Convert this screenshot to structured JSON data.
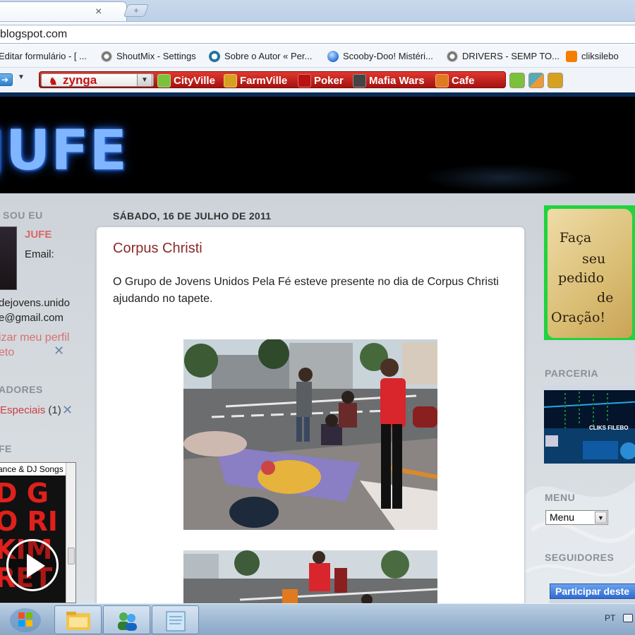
{
  "browser": {
    "tab_close": "×",
    "new_tab": "+",
    "url": "blogspot.com"
  },
  "bookmarks": [
    {
      "label": "Editar formulário - [ ...",
      "icon": "form-icon",
      "color": "#3a7"
    },
    {
      "label": "ShoutMix - Settings",
      "icon": "globe-icon",
      "color": "#666"
    },
    {
      "label": "Sobre o Autor « Per...",
      "icon": "wordpress-icon",
      "color": "#21759b"
    },
    {
      "label": "Scooby-Doo! Mistéri...",
      "icon": "globe-icon",
      "color": "#2a6fd6"
    },
    {
      "label": "DRIVERS - SEMP TO...",
      "icon": "globe-icon",
      "color": "#666"
    },
    {
      "label": "cliksilebo",
      "icon": "blogger-icon",
      "color": "#f57d00"
    }
  ],
  "zynga_toolbar": {
    "brand": "zynga",
    "games": [
      {
        "label": "CityVille",
        "icon": "cityville-icon",
        "color": "#7cc13a"
      },
      {
        "label": "FarmVille",
        "icon": "farmville-icon",
        "color": "#d8a020"
      },
      {
        "label": "Poker",
        "icon": "poker-icon",
        "color": "#b11"
      },
      {
        "label": "Mafia Wars",
        "icon": "mafiawars-icon",
        "color": "#444"
      },
      {
        "label": "Cafe",
        "icon": "cafe-icon",
        "color": "#e07a20"
      }
    ]
  },
  "blog": {
    "title": "JUFE"
  },
  "left_sidebar": {
    "about_heading": "SOU EU",
    "profile_name": "JUFE",
    "email_label": "Email:",
    "email_line1": "dejovens.unido",
    "email_line2": "e@gmail.com",
    "link1": "izar meu perfil",
    "link2": "eto",
    "markers_heading": "ADORES",
    "marker_label": "Especiais",
    "marker_count": " (1)",
    "player_heading": "FE",
    "player_title": "ance & DJ Songs",
    "player_art": [
      "D G",
      "O RI",
      "KIM",
      "RET"
    ]
  },
  "post": {
    "date": "SÁBADO, 16 DE JULHO DE 2011",
    "title": "Corpus Christi",
    "body": "O Grupo de Jovens Unidos Pela Fé esteve presente no dia de Corpus Christi ajudando no tapete."
  },
  "right_sidebar": {
    "prayer_lines": [
      "Faça",
      "seu",
      "pedido",
      "de",
      "Oração!"
    ],
    "parceria_heading": "PARCERIA",
    "parceria_banner_text": "CLIKS FILEBO",
    "menu_heading": "MENU",
    "menu_value": "Menu",
    "followers_heading": "SEGUIDORES",
    "follow_button": "Participar deste"
  },
  "taskbar": {
    "language": "PT"
  },
  "colors": {
    "post_title": "#8a2a2a",
    "sidebar_link": "#d87070",
    "zynga_red": "#c41414",
    "header_glow": "#7fb6ff"
  }
}
